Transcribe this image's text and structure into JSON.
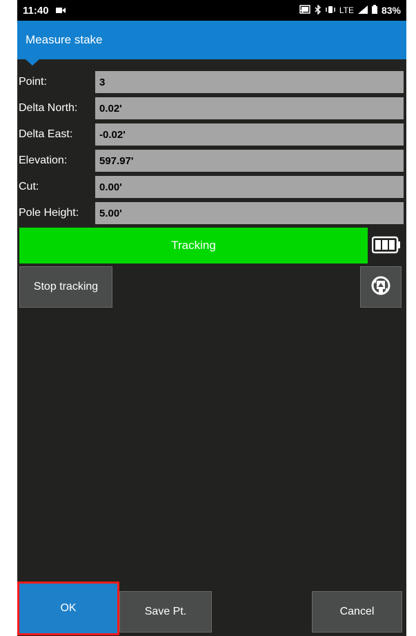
{
  "status_bar": {
    "time": "11:40",
    "network": "LTE",
    "battery": "83%"
  },
  "title": "Measure stake",
  "fields": [
    {
      "label": "Point:",
      "value": "3"
    },
    {
      "label": "Delta North:",
      "value": "0.02'"
    },
    {
      "label": "Delta East:",
      "value": "-0.02'"
    },
    {
      "label": "Elevation:",
      "value": "597.97'"
    },
    {
      "label": "Cut:",
      "value": "0.00'"
    },
    {
      "label": "Pole Height:",
      "value": "5.00'"
    }
  ],
  "tracking": {
    "status": "Tracking",
    "color": "#00d800"
  },
  "buttons": {
    "stop_tracking": "Stop tracking",
    "ok": "OK",
    "save_pt": "Save Pt.",
    "cancel": "Cancel"
  },
  "icons": {
    "cast": "cast-icon",
    "bluetooth": "bluetooth-icon",
    "vibrate": "vibrate-icon",
    "signal": "signal-icon",
    "battery": "battery-icon",
    "prism_settings": "prism-settings-icon"
  }
}
